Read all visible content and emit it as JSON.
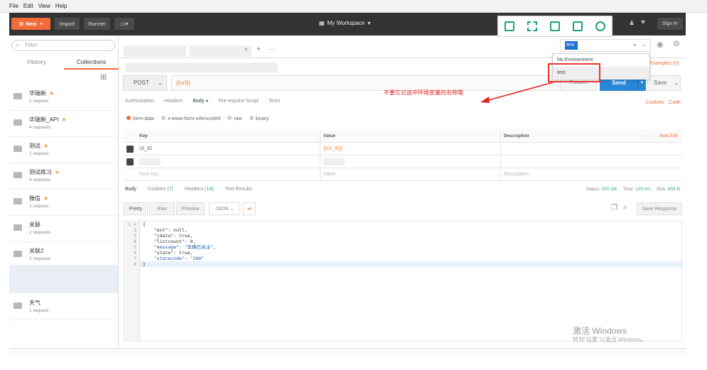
{
  "menubar": {
    "items": [
      "File",
      "Edit",
      "View",
      "Help"
    ]
  },
  "toolbar": {
    "new_label": "New",
    "import_label": "Import",
    "runner_label": "Runner",
    "workspace_label": "My Workspace",
    "signin_label": "Sign In"
  },
  "sidebar": {
    "filter_placeholder": "Filter",
    "tabs": [
      "History",
      "Collections"
    ],
    "collections": [
      {
        "name": "华瑞新",
        "requests": "1 request",
        "starred": true
      },
      {
        "name": "华瑞新_API",
        "requests": "4 requests",
        "starred": true
      },
      {
        "name": "测试",
        "requests": "1 request",
        "starred": true
      },
      {
        "name": "测试练习",
        "requests": "4 requests",
        "starred": true
      },
      {
        "name": "微信",
        "requests": "1 request",
        "starred": true
      },
      {
        "name": "关联",
        "requests": "2 requests",
        "starred": false
      },
      {
        "name": "关联2",
        "requests": "3 requests",
        "starred": false
      },
      {
        "name": "天气",
        "requests": "1 request",
        "starred": false
      }
    ]
  },
  "request": {
    "method": "POST",
    "url": "{{url}}",
    "params_label": "Params",
    "send_label": "Send",
    "save_label": "Save"
  },
  "request_tabs": [
    "Authorization",
    "Headers",
    "Body",
    "Pre-request Script",
    "Tests"
  ],
  "request_links": [
    "Cookies",
    "Code"
  ],
  "body_modes": [
    "form-data",
    "x-www-form-urlencoded",
    "raw",
    "binary"
  ],
  "kv_table": {
    "headers": [
      "Key",
      "Value",
      "Description"
    ],
    "bulk_edit": "Bulk Edit",
    "rows": [
      {
        "key": "UI_ID",
        "value": "{{UI_ID}}",
        "desc": ""
      }
    ],
    "new_key_placeholder": "New key",
    "value_placeholder": "Value",
    "desc_placeholder": "Description"
  },
  "response_tabs": [
    "Body",
    "Cookies (7)",
    "Headers (14)",
    "Test Results"
  ],
  "response_status": {
    "status_label": "Status:",
    "status": "200 OK",
    "time_label": "Time:",
    "time": "120 ms",
    "size_label": "Size:",
    "size": "655 B"
  },
  "response_toolbar": {
    "pretty": "Pretty",
    "raw": "Raw",
    "preview": "Preview",
    "format": "JSON",
    "save_response": "Save Response"
  },
  "response_code": [
    "{",
    "    \"ext\": null,",
    "    \"jdata\": true,",
    "    \"listcount\": 0,",
    "    \"message\": \"车辆已关注\",",
    "    \"state\": true,",
    "    \"statecode\": \"200\"",
    "}"
  ],
  "environment": {
    "selected": "test",
    "options": [
      "No Environment",
      "test"
    ],
    "examples_label": "Examples (0)"
  },
  "annotation": "不要忘记选中环境变量的名称哦",
  "watermark": {
    "title": "激活 Windows",
    "subtitle": "转到\"设置\"以激活 Windows。"
  }
}
